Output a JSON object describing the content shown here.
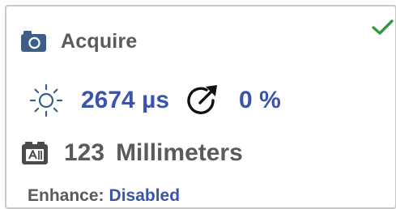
{
  "panel": {
    "title": "Acquire",
    "status_icon": "checkmark-icon",
    "status_color": "#2e9b3f"
  },
  "exposure": {
    "icon": "sun-icon",
    "value": "2674 µs"
  },
  "gain": {
    "icon": "gauge-icon",
    "value": "0 %"
  },
  "distance": {
    "icon": "focus-distance-icon",
    "value": "123",
    "unit": "Millimeters"
  },
  "enhance": {
    "label": "Enhance:",
    "value": "Disabled"
  },
  "colors": {
    "accent": "#3a55a8",
    "text": "#5a5a5a",
    "icon_blue": "#3d5f85",
    "border": "#c9c9c9"
  }
}
